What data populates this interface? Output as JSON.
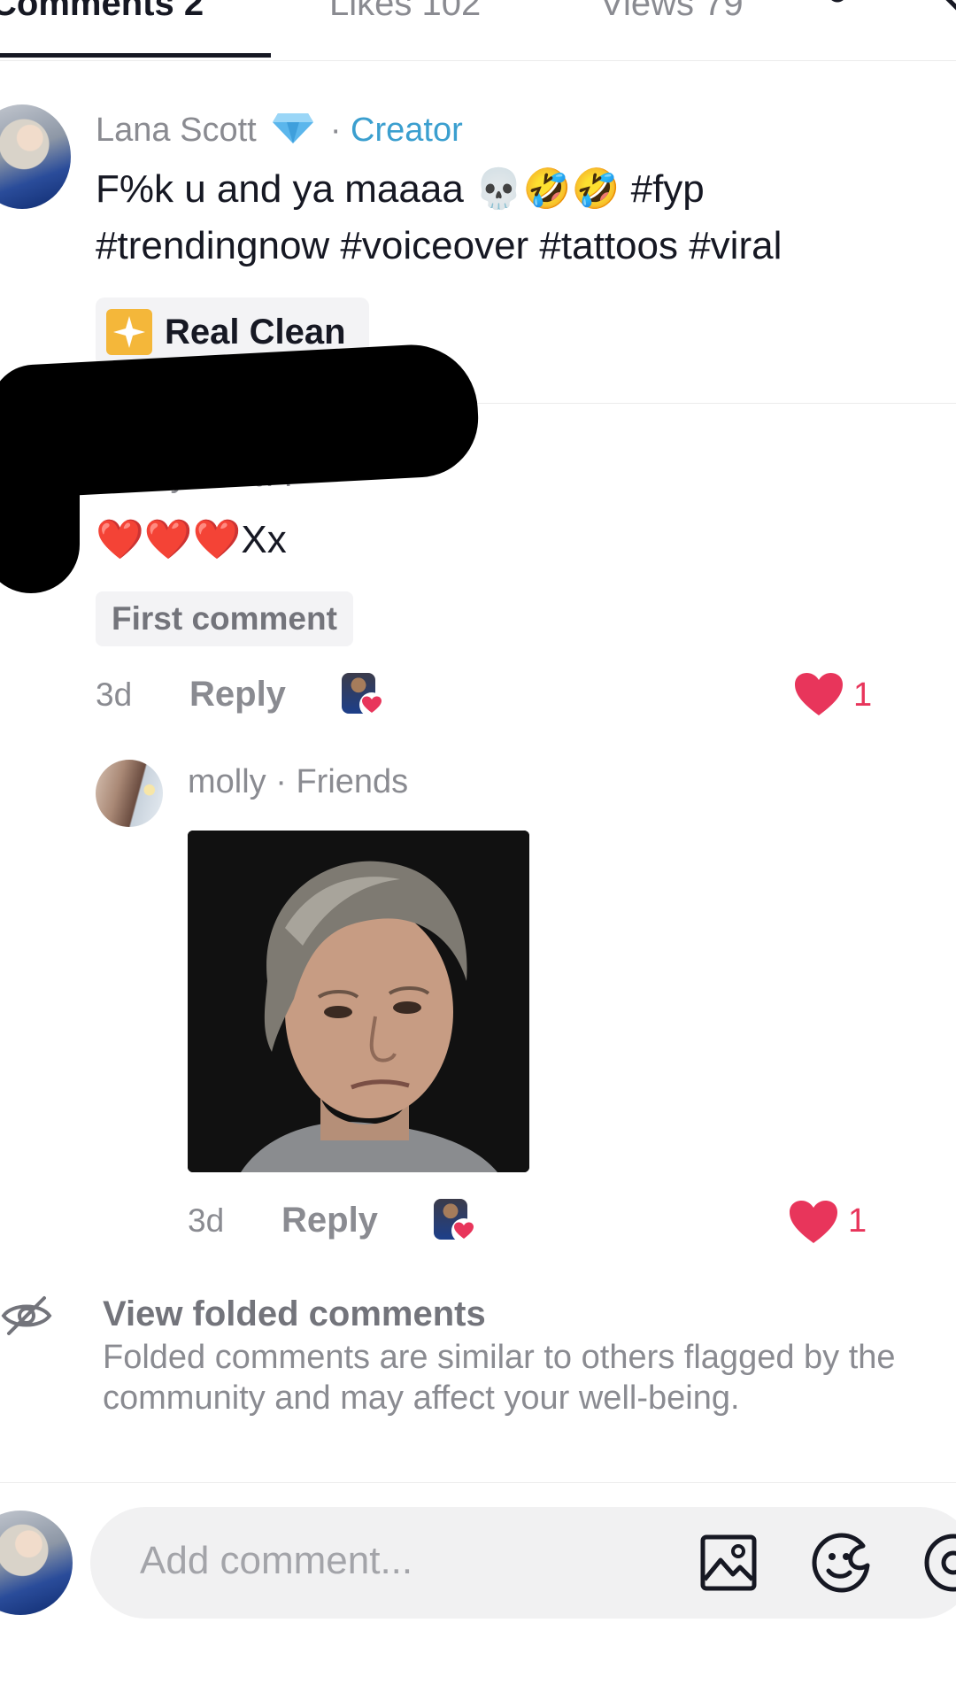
{
  "tabs": [
    {
      "label": "Comments 2"
    },
    {
      "label": "Likes 102"
    },
    {
      "label": "Views 79"
    }
  ],
  "icons": {
    "filter": "filter-sliders-icon",
    "close": "close-icon",
    "verified": "diamond-badge-icon",
    "sound": "sparkle-sound-icon",
    "like": "heart-icon",
    "hidden": "eye-slash-icon",
    "image": "image-icon",
    "emoji": "emoji-icon",
    "mention": "at-mention-icon"
  },
  "colors": {
    "like": "#e8355b",
    "creator": "#3b9fcf",
    "muted": "#8a8b91",
    "text": "#161823"
  },
  "post": {
    "author": "Lana Scott",
    "separator": "·",
    "role": "Creator",
    "caption_line1": "F%k u and ya maaaa 💀🤣🤣 #fyp",
    "caption_line2": "#trendingnow #voiceover #tattoos #viral",
    "sound": "Real Clean"
  },
  "comments": [
    {
      "author": "shortyshort77",
      "text": "❤️❤️❤️Xx",
      "badge": "First comment",
      "time": "3d",
      "reply_label": "Reply",
      "likes": "1"
    },
    {
      "author": "molly",
      "relation": "· Friends",
      "time": "3d",
      "reply_label": "Reply",
      "likes": "1"
    }
  ],
  "folded": {
    "title": "View folded comments",
    "line1": "Folded comments are similar to others flagged by the",
    "line2": "community and may affect your well-being."
  },
  "composer": {
    "placeholder": "Add comment..."
  }
}
